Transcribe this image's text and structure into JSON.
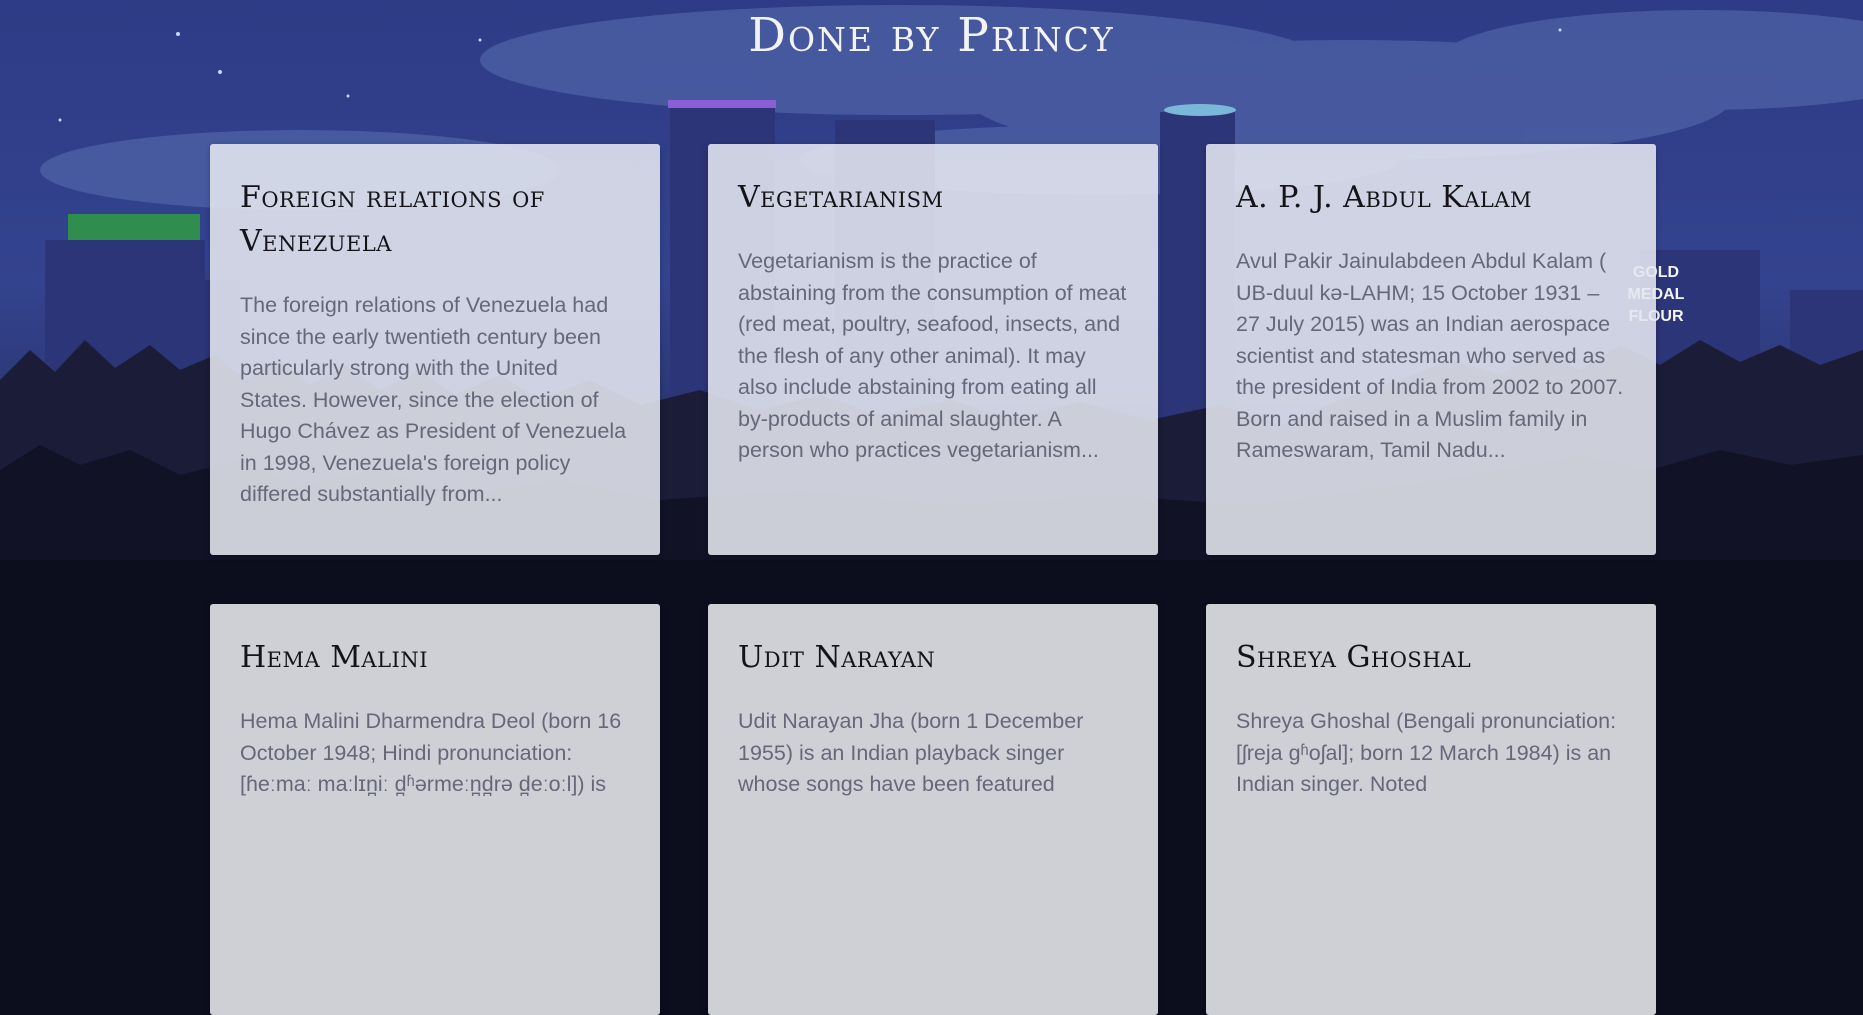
{
  "header": {
    "title": "Done by Princy"
  },
  "background": {
    "sign_text": [
      "GOLD",
      "MEDAL",
      "FLOUR"
    ]
  },
  "cards": [
    {
      "title": "Foreign relations of Venezuela",
      "text": "The foreign relations of Venezuela had since the early twentieth century been particularly strong with the United States. However, since the election of Hugo Chávez as President of Venezuela in 1998, Venezuela's foreign policy differed substantially from..."
    },
    {
      "title": "Vegetarianism",
      "text": "Vegetarianism is the practice of abstaining from the consumption of meat (red meat, poultry, seafood, insects, and the flesh of any other animal). It may also include abstaining from eating all by-products of animal slaughter. A person who practices vegetarianism..."
    },
    {
      "title": "A. P. J. Abdul Kalam",
      "text": "Avul Pakir Jainulabdeen Abdul Kalam ( UB-duul kə-LAHM; 15 October 1931 – 27 July 2015) was an Indian aerospace scientist and statesman who served as the president of India from 2002 to 2007. Born and raised in a Muslim family in Rameswaram, Tamil Nadu..."
    },
    {
      "title": "Hema Malini",
      "text": "Hema Malini Dharmendra Deol (born 16 October 1948; Hindi pronunciation: [ɦeːmaː maːlɪn̪iː d̪ʱərmeːn̪d̪rə d̪eːoːl]) is"
    },
    {
      "title": "Udit Narayan",
      "text": "Udit Narayan Jha (born 1 December 1955) is an Indian playback singer whose songs have been featured"
    },
    {
      "title": "Shreya Ghoshal",
      "text": "Shreya Ghoshal (Bengali pronunciation: [ʃreja ɡʱoʃal]; born 12 March 1984) is an Indian singer. Noted"
    }
  ]
}
